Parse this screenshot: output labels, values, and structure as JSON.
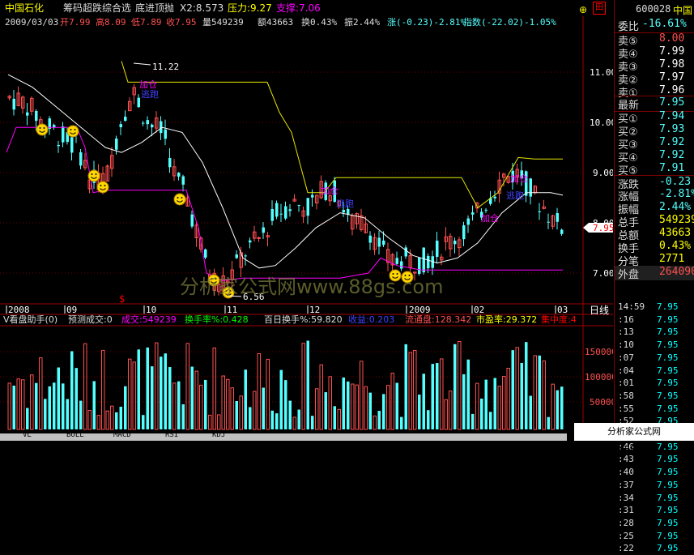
{
  "header": {
    "stock_name": "中国石化",
    "indicator": "筹码超跌综合选",
    "indicator2": "底进顶抛",
    "x2": "X2:8.573",
    "pressure": "压力:9.27",
    "support": "支撑:7.06"
  },
  "info": {
    "date": "2009/03/03",
    "open": "开7.99",
    "high": "高8.09",
    "low": "低7.89",
    "close": "收7.95",
    "volume": "量549239",
    "amount": "额43663",
    "turnover": "换0.43%",
    "amplitude": "振2.44%",
    "change": "涨(-0.23)-2.81%",
    "index": "指数(-22.02)-1.05%"
  },
  "price_axis": [
    "11.00",
    "10.00",
    "9.00",
    "8.00",
    "7.00"
  ],
  "current_price": "7.95",
  "annotations": {
    "high_value": "11.22",
    "low_value": "6.56",
    "s_marker": "$",
    "buy_labels": [
      "加仓",
      "加仓",
      "加仓",
      "加仓"
    ],
    "run_label": "逃跑",
    "watermark": "分析家公式网www.88gs.com"
  },
  "date_axis": [
    "2008",
    "09",
    "10",
    "11",
    "12",
    "2009",
    "02",
    "03"
  ],
  "period_button": "日线",
  "volume_panel": {
    "title": "V看盘助手(0)",
    "predict": "预测成交:0",
    "volume": "成交:549239",
    "turnover_rate": "换手率%:0.428",
    "hundred_day": "百日换手%:59.820",
    "income": "收益:0.203",
    "float_shares": "流通盘:128.342",
    "pe": "市盈率:29.372",
    "concentration": "集中度:4",
    "axis": [
      "150000",
      "100000",
      "50000"
    ]
  },
  "right_panel": {
    "code": "600028",
    "name": "中国",
    "wei_bi": "委比",
    "wei_bi_val": "-16.61%",
    "sell": [
      {
        "label": "卖⑤",
        "price": "8.00"
      },
      {
        "label": "卖④",
        "price": "7.99"
      },
      {
        "label": "卖③",
        "price": "7.98"
      },
      {
        "label": "卖②",
        "price": "7.97"
      },
      {
        "label": "卖①",
        "price": "7.96"
      }
    ],
    "latest_label": "最新",
    "latest": "7.95",
    "buy": [
      {
        "label": "买①",
        "price": "7.94"
      },
      {
        "label": "买②",
        "price": "7.93"
      },
      {
        "label": "买③",
        "price": "7.92"
      },
      {
        "label": "买④",
        "price": "7.92"
      },
      {
        "label": "买⑤",
        "price": "7.91"
      }
    ],
    "stats": [
      {
        "label": "涨跌",
        "value": "-0.23"
      },
      {
        "label": "涨幅",
        "value": "-2.81%"
      },
      {
        "label": "振幅",
        "value": "2.44%"
      },
      {
        "label": "总手",
        "value": "549239"
      },
      {
        "label": "总额",
        "value": "43663"
      },
      {
        "label": "换手",
        "value": "0.43%"
      },
      {
        "label": "分笔",
        "value": "2771"
      },
      {
        "label": "外盘",
        "value": "264090"
      }
    ],
    "ticks": [
      {
        "t": "14:59",
        "p": "7.95"
      },
      {
        "t": ":16",
        "p": "7.95"
      },
      {
        "t": ":13",
        "p": "7.95"
      },
      {
        "t": ":10",
        "p": "7.95"
      },
      {
        "t": ":07",
        "p": "7.95"
      },
      {
        "t": ":04",
        "p": "7.95"
      },
      {
        "t": ":01",
        "p": "7.95"
      },
      {
        "t": ":58",
        "p": "7.95"
      },
      {
        "t": ":55",
        "p": "7.95"
      },
      {
        "t": ":52",
        "p": "7.95"
      },
      {
        "t": ":49",
        "p": "7.95"
      },
      {
        "t": ":46",
        "p": "7.95"
      },
      {
        "t": ":43",
        "p": "7.95"
      },
      {
        "t": ":40",
        "p": "7.95"
      },
      {
        "t": ":37",
        "p": "7.95"
      },
      {
        "t": ":34",
        "p": "7.95"
      },
      {
        "t": ":31",
        "p": "7.95"
      },
      {
        "t": ":28",
        "p": "7.95"
      },
      {
        "t": ":25",
        "p": "7.95"
      },
      {
        "t": ":22",
        "p": "7.95"
      }
    ]
  },
  "bottom_tabs": [
    "VL",
    "BOLL",
    "MACD",
    "RSI",
    "KDJ"
  ],
  "corner_badge": "分析家公式网www.88gs.com",
  "colors": {
    "up": "#ff5050",
    "down": "#54ffff",
    "yellow": "#e8e800",
    "magenta": "#ff00ff",
    "white": "#ffffff",
    "red": "#ff0000"
  }
}
